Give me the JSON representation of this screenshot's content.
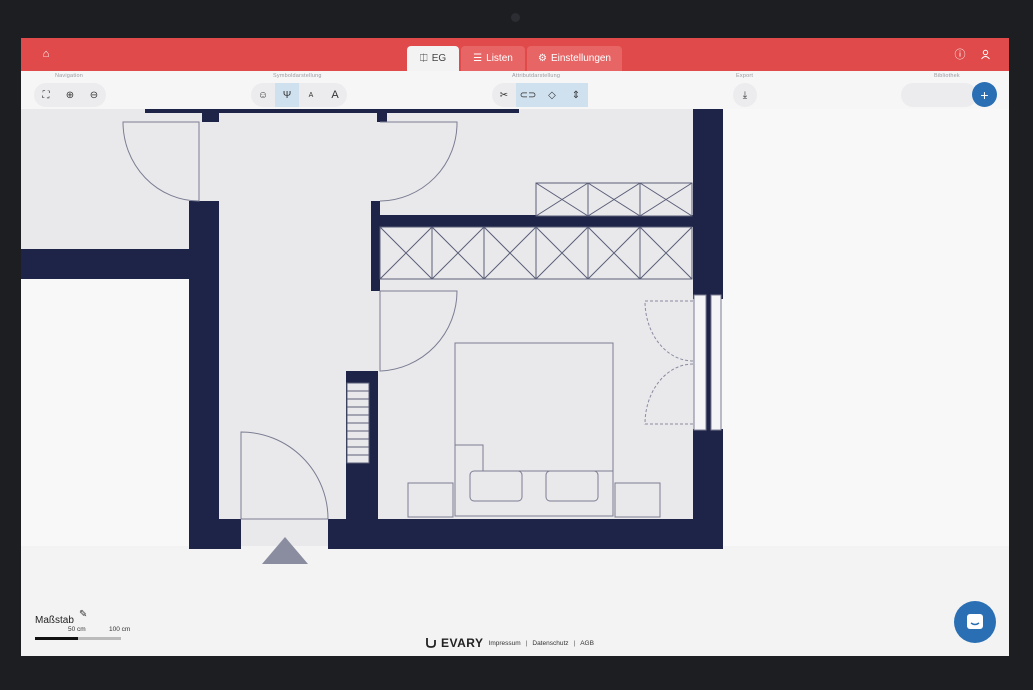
{
  "tabs": [
    {
      "label": "EG",
      "icon": "floorplan-icon",
      "active": true
    },
    {
      "label": "Listen",
      "icon": "list-icon",
      "active": false
    },
    {
      "label": "Einstellungen",
      "icon": "gear-icon",
      "active": false
    }
  ],
  "toolbar": {
    "navigation_label": "Navigation",
    "symbol_label": "Symboldarstellung",
    "attribute_label": "Attributdarstellung",
    "export_label": "Export",
    "library_label": "Bibliothek",
    "add_label": "+"
  },
  "scale": {
    "title": "Maßstab",
    "mark_50": "50 cm",
    "mark_100": "100 cm"
  },
  "footer": {
    "brand": "EVARY",
    "links": [
      "Impressum",
      "Datenschutz",
      "AGB"
    ]
  },
  "colors": {
    "topbar": "#e04a4a",
    "wall": "#1e2447",
    "accent": "#2a6fb3"
  }
}
